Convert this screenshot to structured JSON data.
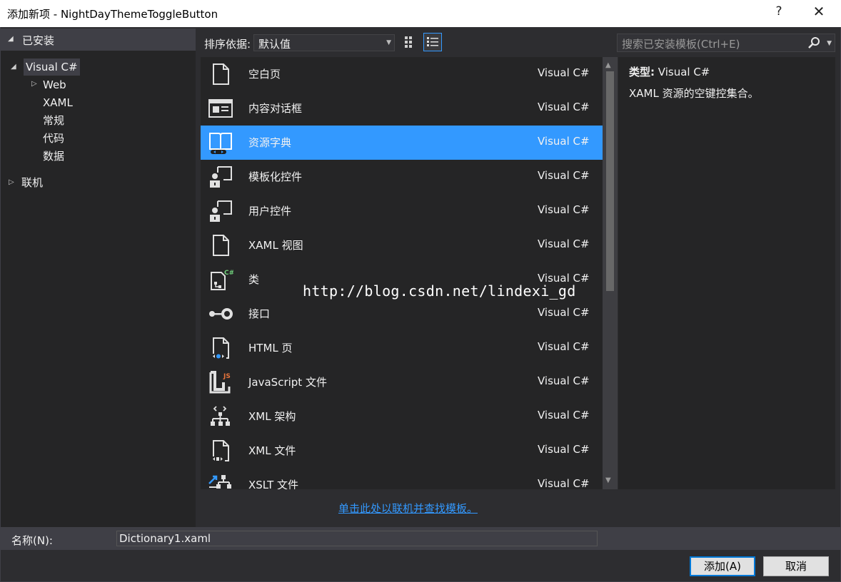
{
  "window": {
    "title": "添加新项 - NightDayThemeToggleButton",
    "help_label": "?",
    "close_label": "✕"
  },
  "left_panel": {
    "installed_label": "已安装",
    "tree": [
      {
        "label": "Visual C#",
        "selected": true
      },
      {
        "label": "Web"
      },
      {
        "label": "XAML"
      },
      {
        "label": "常规"
      },
      {
        "label": "代码"
      },
      {
        "label": "数据"
      },
      {
        "label": "联机"
      }
    ]
  },
  "toolbar": {
    "sort_label": "排序依据:",
    "sort_value": "默认值",
    "search_placeholder": "搜索已安装模板(Ctrl+E)"
  },
  "templates": [
    {
      "name": "空白页",
      "lang": "Visual C#",
      "icon": "blank-page-icon"
    },
    {
      "name": "内容对话框",
      "lang": "Visual C#",
      "icon": "content-dialog-icon"
    },
    {
      "name": "资源字典",
      "lang": "Visual C#",
      "icon": "resource-dictionary-icon",
      "selected": true
    },
    {
      "name": "模板化控件",
      "lang": "Visual C#",
      "icon": "templated-control-icon"
    },
    {
      "name": "用户控件",
      "lang": "Visual C#",
      "icon": "user-control-icon"
    },
    {
      "name": "XAML 视图",
      "lang": "Visual C#",
      "icon": "xaml-view-icon"
    },
    {
      "name": "类",
      "lang": "Visual C#",
      "icon": "class-icon"
    },
    {
      "name": "接口",
      "lang": "Visual C#",
      "icon": "interface-icon"
    },
    {
      "name": "HTML 页",
      "lang": "Visual C#",
      "icon": "html-page-icon"
    },
    {
      "name": "JavaScript 文件",
      "lang": "Visual C#",
      "icon": "javascript-file-icon"
    },
    {
      "name": "XML 架构",
      "lang": "Visual C#",
      "icon": "xml-schema-icon"
    },
    {
      "name": "XML 文件",
      "lang": "Visual C#",
      "icon": "xml-file-icon"
    },
    {
      "name": "XSLT 文件",
      "lang": "Visual C#",
      "icon": "xslt-file-icon"
    }
  ],
  "watermark": "http://blog.csdn.net/lindexi_gd",
  "details": {
    "type_label": "类型:",
    "type_value": "Visual C#",
    "description": "XAML 资源的空键控集合。"
  },
  "online_link": "单击此处以联机并查找模板。",
  "name_field": {
    "label": "名称(N):",
    "value": "Dictionary1.xaml"
  },
  "buttons": {
    "add": "添加(A)",
    "cancel": "取消"
  },
  "colors": {
    "accent": "#3399ff",
    "background": "#2d2d30",
    "panel": "#252526"
  }
}
